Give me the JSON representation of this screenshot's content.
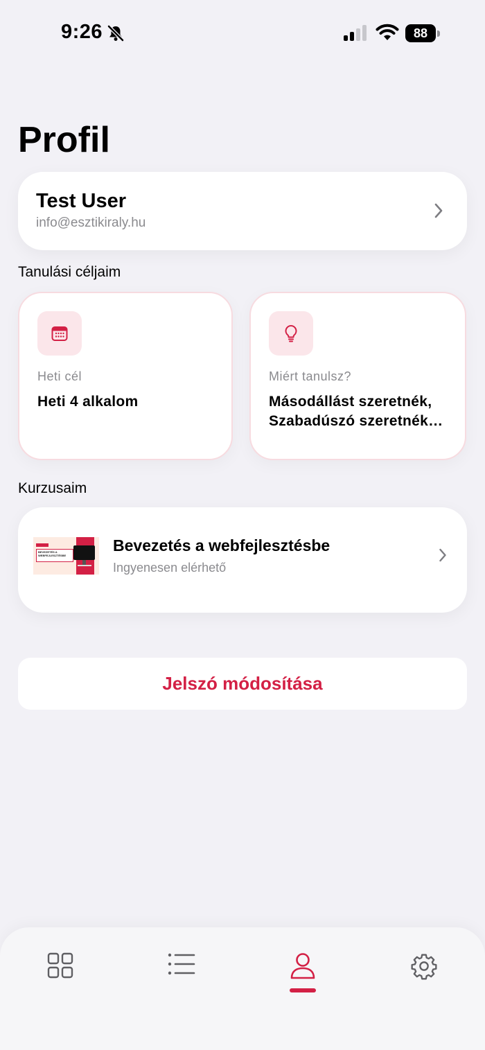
{
  "status_bar": {
    "time": "9:26",
    "battery": "88"
  },
  "page": {
    "title": "Profil"
  },
  "profile": {
    "name": "Test User",
    "email": "info@esztikiraly.hu"
  },
  "goals": {
    "section_label": "Tanulási céljaim",
    "items": [
      {
        "icon": "calendar-icon",
        "label": "Heti cél",
        "value": "Heti 4 alkalom"
      },
      {
        "icon": "lightbulb-icon",
        "label": "Miért tanulsz?",
        "value": "Másodállást szeretnék, Szabadúszó szeretnék lenni"
      }
    ]
  },
  "courses": {
    "section_label": "Kurzusaim",
    "items": [
      {
        "title": "Bevezetés a webfejlesztésbe",
        "subtitle": "Ingyenesen elérhető",
        "thumbnail_text": "BEVEZETÉS A WEBFEJLESZTÉSBE"
      }
    ]
  },
  "actions": {
    "change_password": "Jelszó módosítása"
  },
  "tab_bar": {
    "items": [
      {
        "icon": "grid-icon",
        "active": false
      },
      {
        "icon": "list-icon",
        "active": false
      },
      {
        "icon": "person-icon",
        "active": true
      },
      {
        "icon": "gear-icon",
        "active": false
      }
    ]
  },
  "colors": {
    "accent": "#d32045",
    "accent_light": "#fbe6ea",
    "background": "#f2f1f6",
    "secondary_text": "#8a8a8e"
  }
}
